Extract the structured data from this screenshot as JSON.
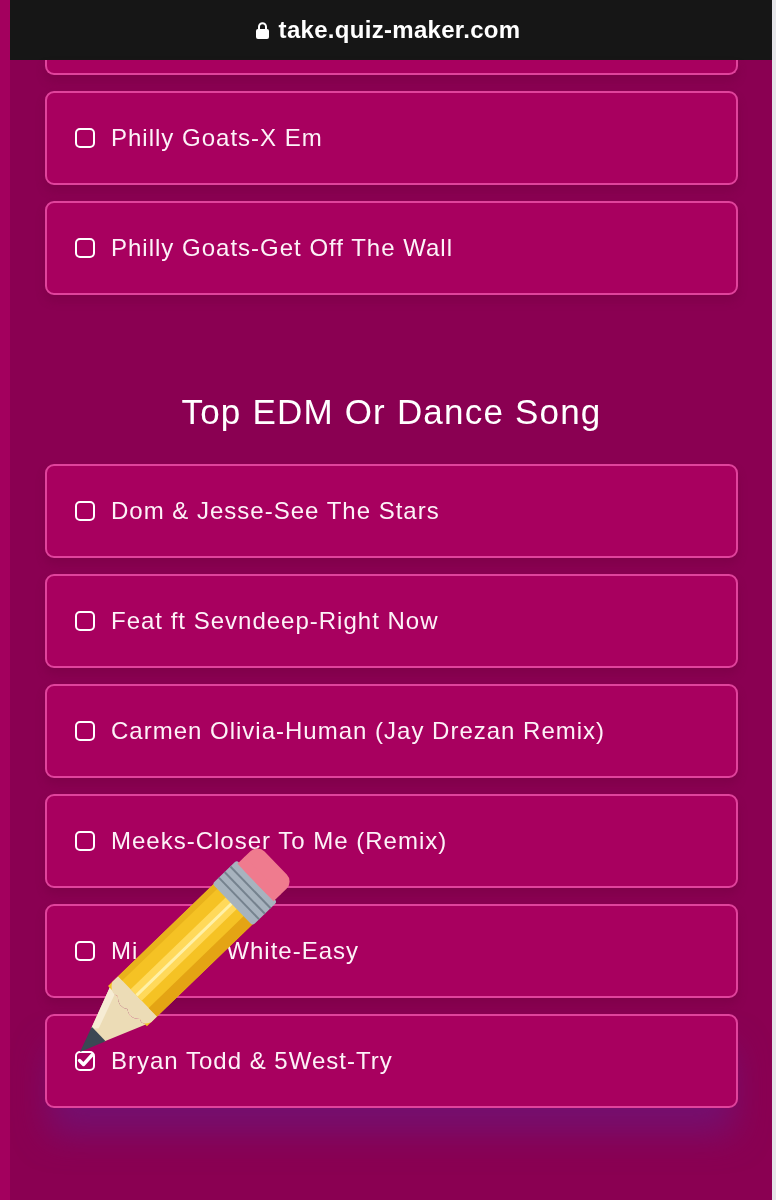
{
  "browser_bar": {
    "url": "take.quiz-maker.com"
  },
  "sections": [
    {
      "options": [
        {
          "texts": [
            "Philly Goats-X Em"
          ],
          "checked": false
        },
        {
          "texts": [
            "Philly Goats-Get Off The Wall"
          ],
          "checked": false
        }
      ]
    },
    {
      "title": "Top EDM Or Dance Song",
      "options": [
        {
          "texts": [
            "Dom & Jesse-See The Stars"
          ],
          "checked": false
        },
        {
          "texts": [
            "Feat ft Sevndeep-Right Now"
          ],
          "checked": false
        },
        {
          "texts": [
            "Carmen Olivia-Human (Jay Drezan Remix)"
          ],
          "checked": false
        },
        {
          "texts": [
            "Meeks-Closer To Me (Remix)"
          ],
          "checked": false
        },
        {
          "texts": [
            "Mi",
            "White-Easy"
          ],
          "checked": false
        },
        {
          "texts": [
            "Bryan Todd & 5West-Try"
          ],
          "checked": true
        }
      ]
    }
  ]
}
